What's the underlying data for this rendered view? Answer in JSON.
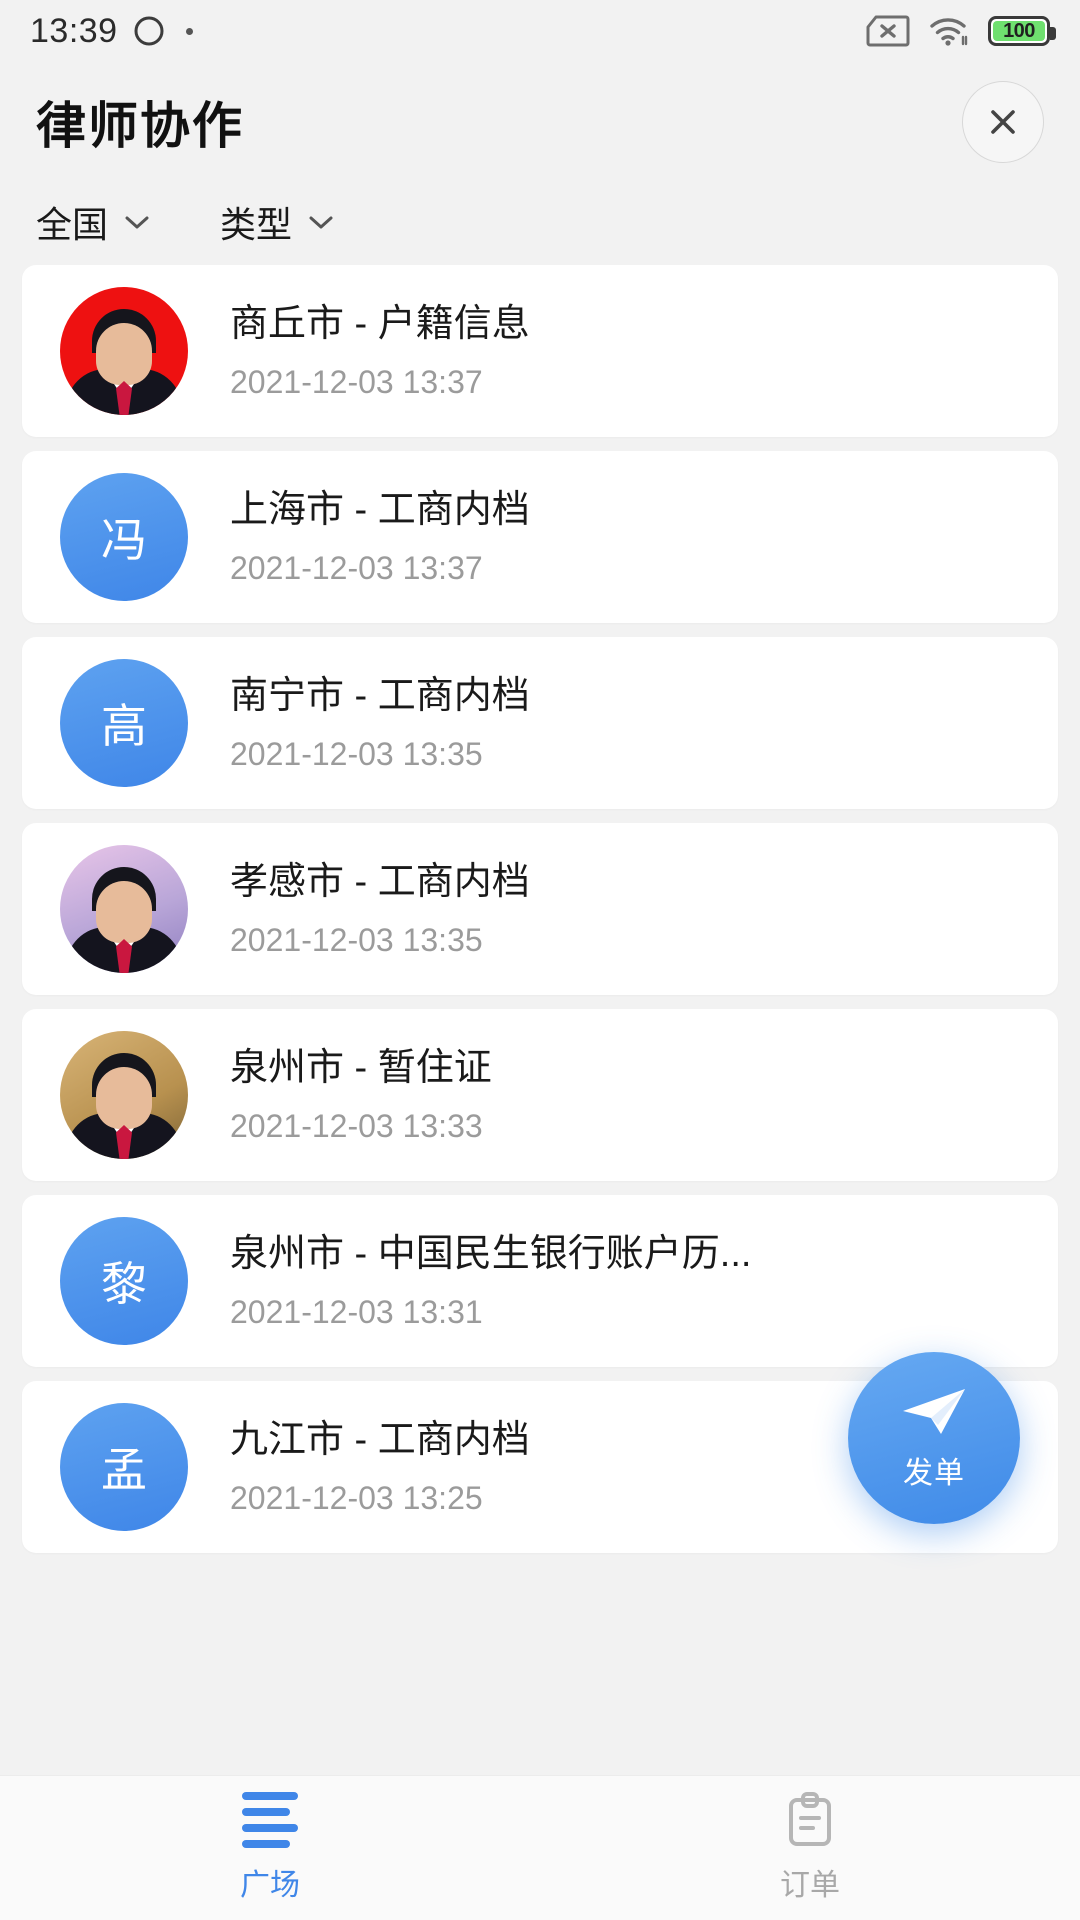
{
  "statusbar": {
    "time": "13:39",
    "quickball_icon": "quickball-icon",
    "dot_icon": "dot-indicator-icon",
    "sim_icon": "sim-card-disabled-icon",
    "wifi_icon": "wifi-icon",
    "battery_icon": "battery-icon",
    "battery_level": "100"
  },
  "header": {
    "title": "律师协作",
    "close_icon": "close-icon"
  },
  "filters": [
    {
      "label": "全国",
      "icon": "chevron-down-icon"
    },
    {
      "label": "类型",
      "icon": "chevron-down-icon"
    }
  ],
  "cards": [
    {
      "avatar_type": "photo-red",
      "avatar_text": "",
      "title": "商丘市 - 户籍信息",
      "time": "2021-12-03 13:37"
    },
    {
      "avatar_type": "initial",
      "avatar_text": "冯",
      "title": "上海市 - 工商内档",
      "time": "2021-12-03 13:37"
    },
    {
      "avatar_type": "initial",
      "avatar_text": "高",
      "title": "南宁市 - 工商内档",
      "time": "2021-12-03 13:35"
    },
    {
      "avatar_type": "photo-pink",
      "avatar_text": "",
      "title": "孝感市 - 工商内档",
      "time": "2021-12-03 13:35"
    },
    {
      "avatar_type": "photo-gold",
      "avatar_text": "",
      "title": "泉州市 - 暂住证",
      "time": "2021-12-03 13:33"
    },
    {
      "avatar_type": "initial",
      "avatar_text": "黎",
      "title": "泉州市 - 中国民生银行账户历...",
      "time": "2021-12-03 13:31"
    },
    {
      "avatar_type": "initial",
      "avatar_text": "孟",
      "title": "九江市 - 工商内档",
      "time": "2021-12-03 13:25"
    }
  ],
  "fab": {
    "label": "发单",
    "icon": "send-paper-plane-icon"
  },
  "bottomnav": [
    {
      "label": "广场",
      "icon": "plaza-lines-icon",
      "active": true
    },
    {
      "label": "订单",
      "icon": "clipboard-orders-icon",
      "active": false
    }
  ],
  "colors": {
    "accent": "#3f86e8",
    "page_bg": "#f2f2f2",
    "card_bg": "#ffffff",
    "title_text": "#1a1a1a",
    "muted_text": "#9b9b9b",
    "battery_green": "#6fe06f"
  }
}
